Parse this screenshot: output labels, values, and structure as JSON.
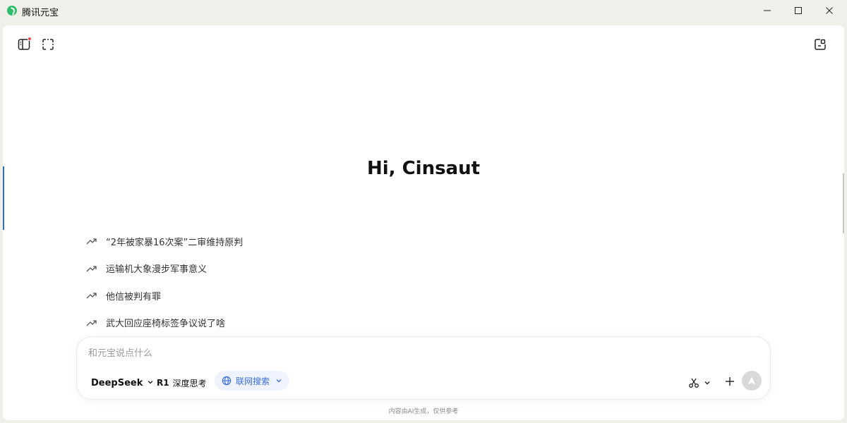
{
  "app": {
    "title": "腾讯元宝"
  },
  "greeting": "Hi, Cinsaut",
  "suggestions": [
    {
      "label": "“2年被家暴16次案”二审维持原判"
    },
    {
      "label": "运输机大象漫步军事意义"
    },
    {
      "label": "他信被判有罪"
    },
    {
      "label": "武大回应座椅标签争议说了啥"
    }
  ],
  "composer": {
    "placeholder": "和元宝说点什么",
    "model_label": "DeepSeek",
    "deep_think_prefix": "R1",
    "deep_think_label": "深度思考",
    "web_search_label": "联网搜索"
  },
  "footnote": "内容由AI生成，仅供参考",
  "colors": {
    "accent": "#3b6fe0",
    "accent_bg": "#eef3fe",
    "notification_dot": "#f04a3e",
    "logo": "#2fbf6a"
  },
  "icons": {
    "sidebar": "sidebar-toggle-icon",
    "capture": "screen-capture-icon",
    "new_chat": "new-chat-icon",
    "trend": "trending-up-icon",
    "globe": "globe-icon",
    "scissors": "scissors-icon",
    "plus": "plus-icon",
    "send": "send-icon"
  }
}
